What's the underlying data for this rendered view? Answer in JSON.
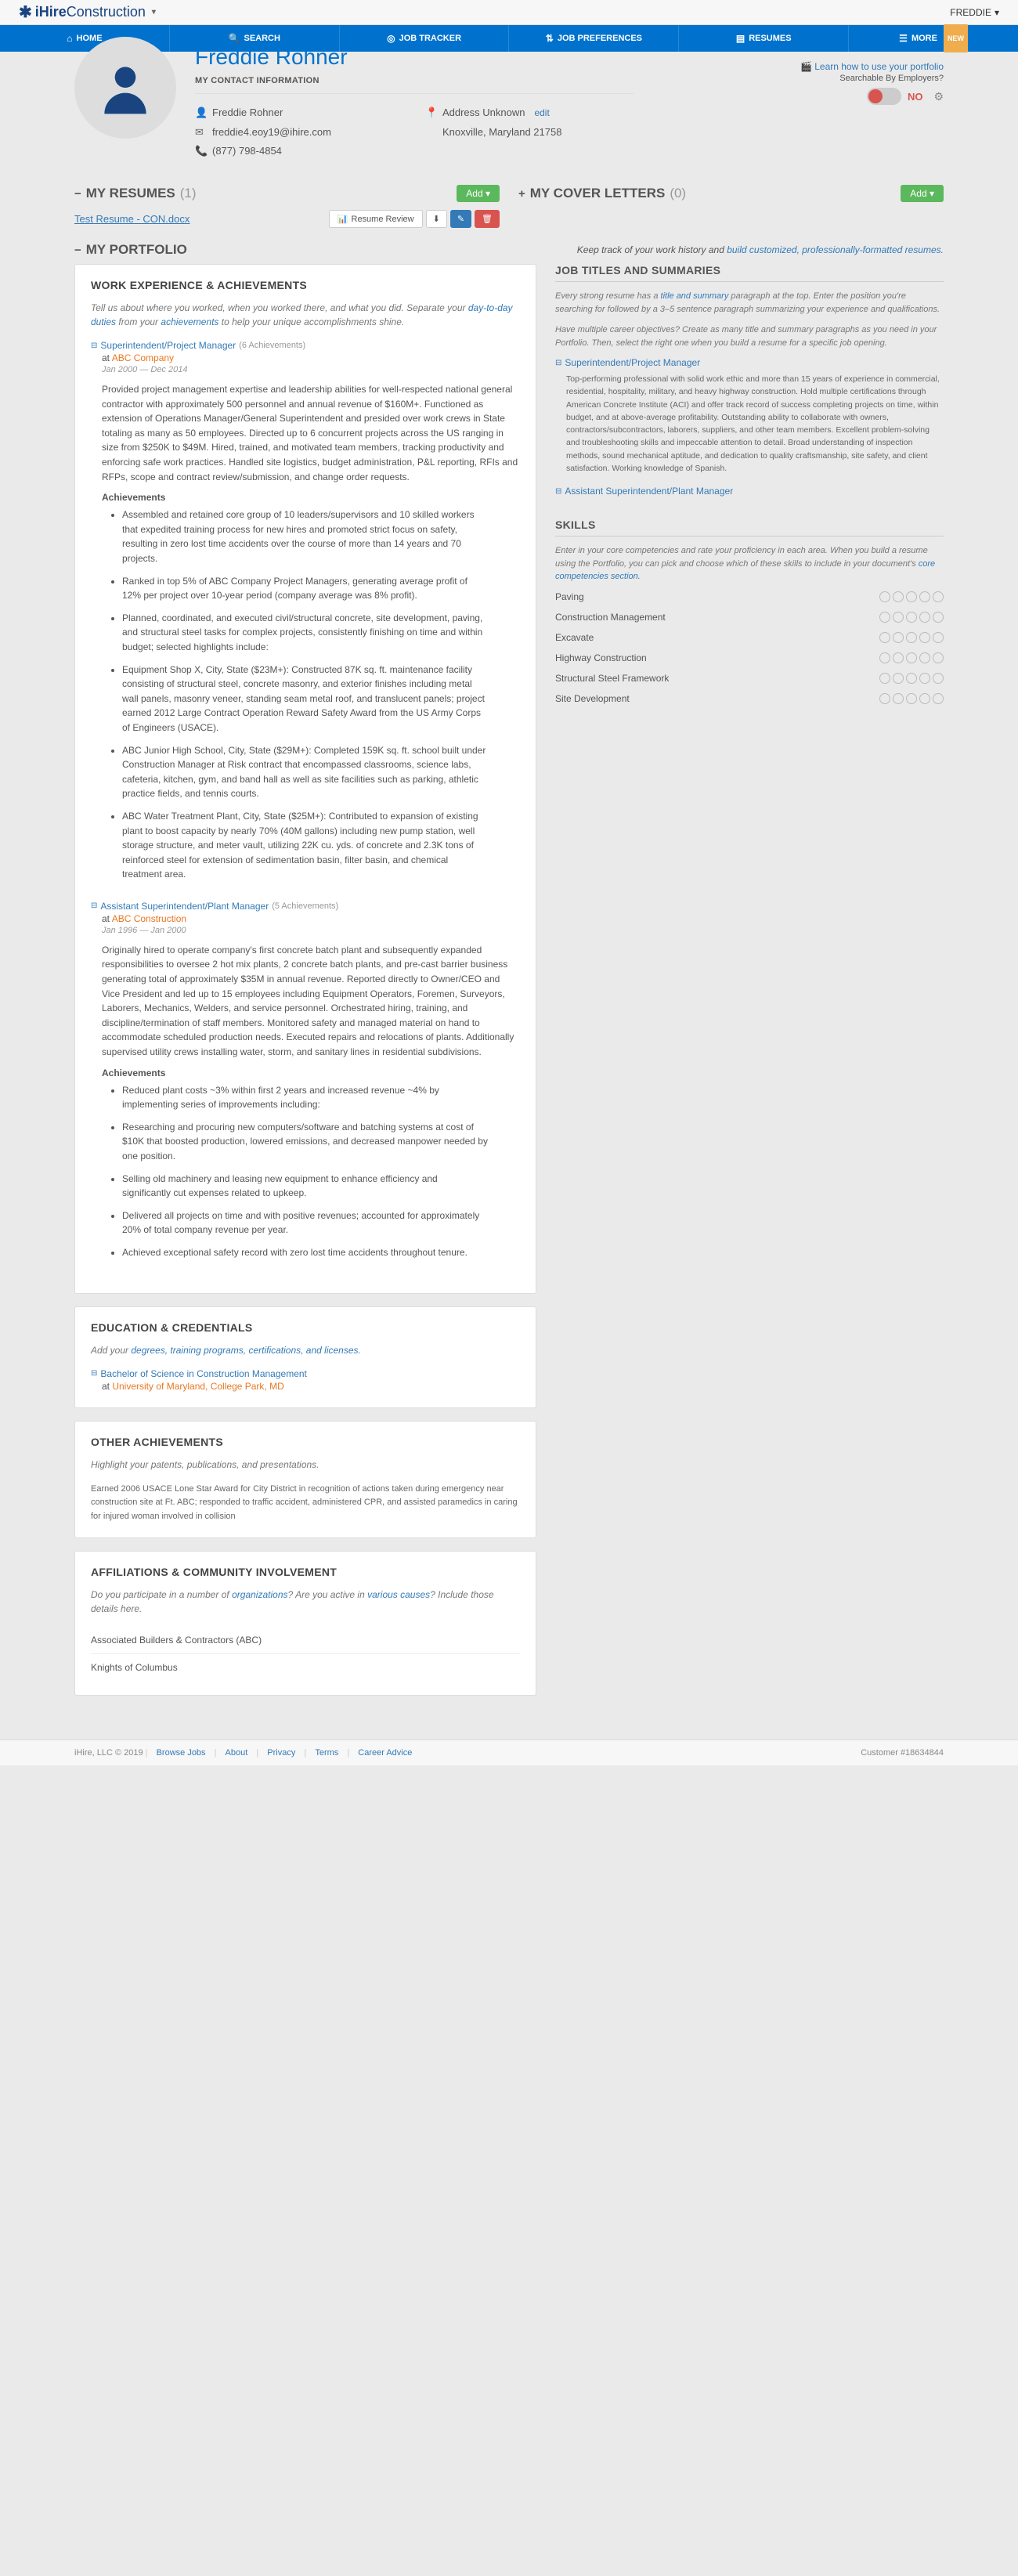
{
  "brand": {
    "prefix": "iHire",
    "suffix": "Construction"
  },
  "user": {
    "name": "FREDDIE"
  },
  "nav": {
    "home": "HOME",
    "search": "SEARCH",
    "jobtracker": "JOB TRACKER",
    "prefs": "JOB PREFERENCES",
    "resumes": "RESUMES",
    "more": "MORE",
    "new": "NEW"
  },
  "header": {
    "learn": "Learn how to use your portfolio",
    "searchable": "Searchable By Employers?",
    "toggle": "NO"
  },
  "profile": {
    "name": "Freddie Rohner",
    "contact_title": "MY CONTACT INFORMATION",
    "full_name": "Freddie Rohner",
    "email": "freddie4.eoy19@ihire.com",
    "phone": "(877) 798-4854",
    "address_label": "Address Unknown",
    "address_edit": "edit",
    "citystate": "Knoxville, Maryland 21758"
  },
  "resumes": {
    "title": "MY RESUMES",
    "count": "(1)",
    "add": "Add",
    "item": "Test Resume - CON.docx",
    "review": "Resume Review"
  },
  "covers": {
    "title": "MY COVER LETTERS",
    "count": "(0)",
    "add": "Add"
  },
  "portfolio": {
    "title": "MY PORTFOLIO",
    "tag_a": "Keep track of your work history and ",
    "tag_b": "build customized, professionally-formatted resumes."
  },
  "work": {
    "title": "WORK EXPERIENCE & ACHIEVEMENTS",
    "intro_a": "Tell us about where you worked, when you worked there, and what you did. Separate your ",
    "intro_b": "day-to-day duties",
    "intro_c": " from your ",
    "intro_d": "achievements",
    "intro_e": " to help your unique accomplishments shine.",
    "ach_label": "Achievements",
    "entries": [
      {
        "title": "Superintendent/Project Manager",
        "achv_count": "(6 Achievements)",
        "company_prefix": "at ",
        "company": "ABC Company",
        "dates": "Jan 2000 — Dec 2014",
        "body": "Provided project management expertise and leadership abilities for well-respected national general contractor with approximately 500 personnel and annual revenue of $160M+. Functioned as extension of Operations Manager/General Superintendent and presided over work crews in State totaling as many as 50 employees. Directed up to 6 concurrent projects across the US ranging in size from $250K to $49M. Hired, trained, and motivated team members, tracking productivity and enforcing safe work practices. Handled site logistics, budget administration, P&L reporting, RFIs and RFPs, scope and contract review/submission, and change order requests.",
        "achv": [
          "Assembled and retained core group of 10 leaders/supervisors and 10 skilled workers that expedited training process for new hires and promoted strict focus on safety, resulting in zero lost time accidents over the course of more than 14 years and 70 projects.",
          "Ranked in top 5% of ABC Company Project Managers, generating average profit of 12% per project over 10-year period (company average was 8% profit).",
          "Planned, coordinated, and executed civil/structural concrete, site development, paving, and structural steel tasks for complex projects, consistently finishing on time and within budget; selected highlights include:",
          "Equipment Shop X, City, State ($23M+): Constructed 87K sq. ft. maintenance facility consisting of structural steel, concrete masonry, and exterior finishes including metal wall panels, masonry veneer, standing seam metal roof, and translucent panels; project earned 2012 Large Contract Operation Reward Safety Award from the US Army Corps of Engineers (USACE).",
          "ABC Junior High School, City, State ($29M+): Completed 159K sq. ft. school built under Construction Manager at Risk contract that encompassed classrooms, science labs, cafeteria, kitchen, gym, and band hall as well as site facilities such as parking, athletic practice fields, and tennis courts.",
          "ABC Water Treatment Plant, City, State ($25M+): Contributed to expansion of existing plant to boost capacity by nearly 70% (40M gallons) including new pump station, well storage structure, and meter vault, utilizing 22K cu. yds. of concrete and 2.3K tons of reinforced steel for extension of sedimentation basin, filter basin, and chemical treatment area."
        ]
      },
      {
        "title": "Assistant Superintendent/Plant Manager",
        "achv_count": "(5 Achievements)",
        "company_prefix": "at ",
        "company": "ABC Construction",
        "dates": "Jan 1996 — Jan 2000",
        "body": "Originally hired to operate company's first concrete batch plant and subsequently expanded responsibilities to oversee 2 hot mix plants, 2 concrete batch plants, and pre-cast barrier business generating total of approximately $35M in annual revenue. Reported directly to Owner/CEO and Vice President and led up to 15 employees including Equipment Operators, Foremen, Surveyors, Laborers, Mechanics, Welders, and service personnel. Orchestrated hiring, training, and discipline/termination of staff members. Monitored safety and managed material on hand to accommodate scheduled production needs. Executed repairs and relocations of plants. Additionally supervised utility crews installing water, storm, and sanitary lines in residential subdivisions.",
        "achv": [
          "Reduced plant costs ~3% within first 2 years and increased revenue ~4% by implementing series of improvements including:",
          "Researching and procuring new computers/software and batching systems at cost of $10K that boosted production, lowered emissions, and decreased manpower needed by one position.",
          "Selling old machinery and leasing new equipment to enhance efficiency and significantly cut expenses related to upkeep.",
          "Delivered all projects on time and with positive revenues; accounted for approximately 20% of total company revenue per year.",
          "Achieved exceptional safety record with zero lost time accidents throughout tenure."
        ]
      }
    ]
  },
  "edu": {
    "title": "EDUCATION & CREDENTIALS",
    "intro_a": "Add your ",
    "intro_b": "degrees, training programs, certifications, and licenses.",
    "degree": "Bachelor of Science in Construction Management",
    "school_prefix": "at ",
    "school": "University of Maryland, College Park, MD"
  },
  "other": {
    "title": "OTHER ACHIEVEMENTS",
    "intro": "Highlight your patents, publications, and presentations.",
    "body": "Earned 2006 USACE Lone Star Award for City District in recognition of actions taken during emergency near construction site at Ft. ABC; responded to traffic accident, administered CPR, and assisted paramedics in caring for injured woman involved in collision"
  },
  "affil": {
    "title": "AFFILIATIONS & COMMUNITY INVOLVEMENT",
    "intro_a": "Do you participate in a number of ",
    "intro_b": "organizations",
    "intro_c": "? Are you active in ",
    "intro_d": "various causes",
    "intro_e": "? Include those details here.",
    "items": [
      "Associated Builders & Contractors (ABC)",
      "Knights of Columbus"
    ]
  },
  "jts": {
    "title": "JOB TITLES AND SUMMARIES",
    "intro_a": "Every strong resume has a ",
    "intro_b": "title and summary",
    "intro_c": " paragraph at the top. Enter the position you're searching for followed by a 3–5 sentence paragraph summarizing your experience and qualifications.",
    "intro2": "Have multiple career objectives? Create as many title and summary paragraphs as you need in your Portfolio. Then, select the right one when you build a resume for a specific job opening.",
    "items": [
      {
        "title": "Superintendent/Project Manager",
        "summary": "Top-performing professional with solid work ethic and more than 15 years of experience in commercial, residential, hospitality, military, and heavy highway construction. Hold multiple certifications through American Concrete Institute (ACI) and offer track record of success completing projects on time, within budget, and at above-average profitability. Outstanding ability to collaborate with owners, contractors/subcontractors, laborers, suppliers, and other team members. Excellent problem-solving and troubleshooting skills and impeccable attention to detail. Broad understanding of inspection methods, sound mechanical aptitude, and dedication to quality craftsmanship, site safety, and client satisfaction. Working knowledge of Spanish."
      },
      {
        "title": "Assistant Superintendent/Plant Manager"
      }
    ]
  },
  "skills": {
    "title": "SKILLS",
    "intro_a": "Enter in your core competencies and rate your proficiency in each area. When you build a resume using the Portfolio, you can pick and choose which of these skills to include in your document's ",
    "intro_b": "core competencies section.",
    "items": [
      "Paving",
      "Construction Management",
      "Excavate",
      "Highway Construction",
      "Structural Steel Framework",
      "Site Development"
    ]
  },
  "footer": {
    "copy": "iHire, LLC © 2019",
    "links": [
      "Browse Jobs",
      "About",
      "Privacy",
      "Terms",
      "Career Advice"
    ],
    "customer": "Customer #18634844"
  }
}
